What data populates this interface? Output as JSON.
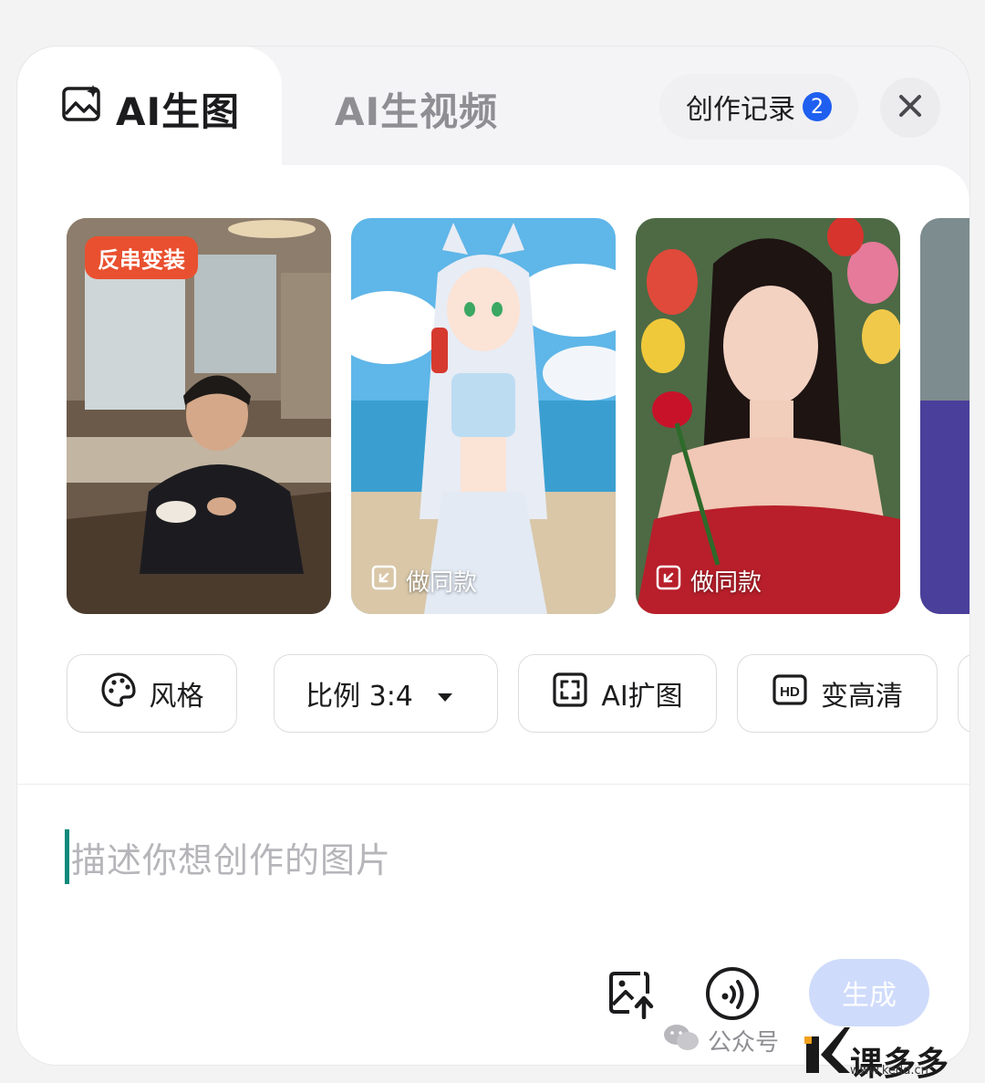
{
  "tabs": {
    "image_label": "AI生图",
    "video_label": "AI生视频",
    "active": "image"
  },
  "header": {
    "history_label": "创作记录",
    "history_count": "2"
  },
  "examples": [
    {
      "tag": "反串变装",
      "action": ""
    },
    {
      "tag": "",
      "action": "做同款"
    },
    {
      "tag": "",
      "action": "做同款"
    }
  ],
  "tools": {
    "style_label": "风格",
    "ratio_label": "比例 3:4",
    "expand_label": "AI扩图",
    "hd_label": "变高清"
  },
  "prompt": {
    "placeholder": "描述你想创作的图片"
  },
  "actions": {
    "generate_label": "生成"
  },
  "watermark": {
    "account_label": "公众号",
    "logo_text": "课多多",
    "logo_url": "www.kedd.cn"
  },
  "colors": {
    "accent": "#1f5ff0",
    "generate_bg": "#cfdbfb",
    "tag_bg": "#e9502f",
    "caret": "#0f8a7a"
  }
}
